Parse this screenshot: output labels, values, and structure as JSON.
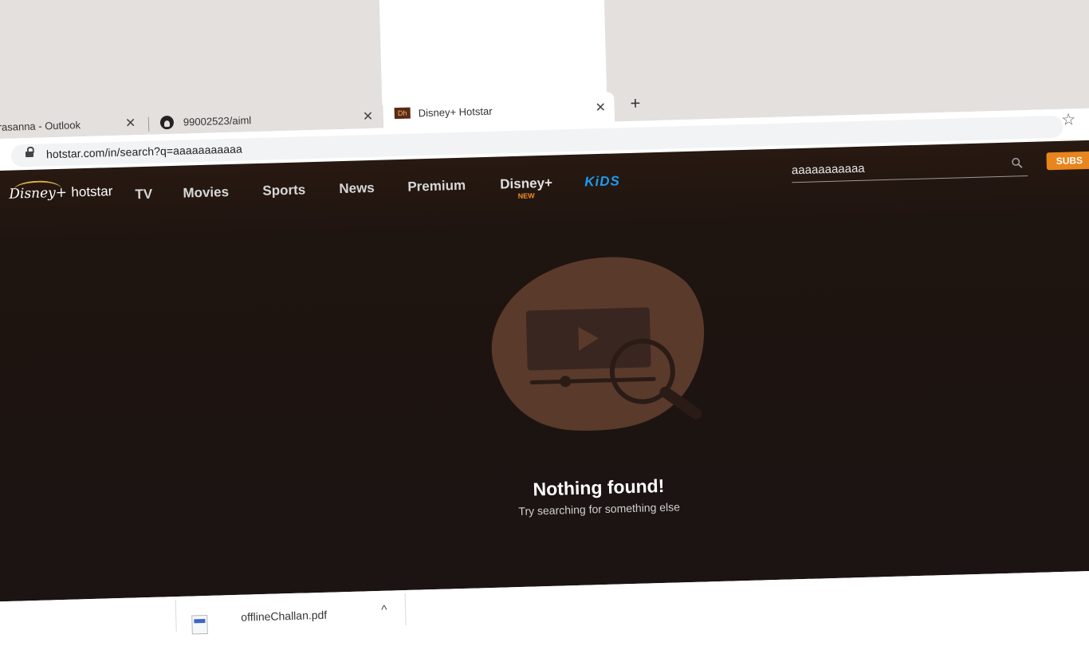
{
  "browser": {
    "tabs": [
      {
        "title": "Prasanna - Outlook",
        "icon": "outlook-icon"
      },
      {
        "title": "99002523/aiml",
        "icon": "github-icon"
      },
      {
        "title": "Disney+ Hotstar",
        "icon": "hotstar-favicon",
        "active": true
      }
    ],
    "close_glyph": "✕",
    "new_tab_glyph": "+",
    "url": "hotstar.com/in/search?q=aaaaaaaaaaa",
    "favicon_text": "Dh"
  },
  "hotstar": {
    "logo": {
      "brand": "Disney+",
      "name": "hotstar"
    },
    "nav": [
      {
        "label": "TV"
      },
      {
        "label": "Movies"
      },
      {
        "label": "Sports"
      },
      {
        "label": "News"
      },
      {
        "label": "Premium"
      },
      {
        "label": "Disney+",
        "badge": "NEW"
      },
      {
        "label": "KiDS"
      }
    ],
    "search_value": "aaaaaaaaaaa",
    "subscribe_label": "SUBS",
    "empty_title": "Nothing found!",
    "empty_subtitle": "Try searching for something else"
  },
  "downloads": {
    "file": "offlineChallan.pdf",
    "chevron": "^"
  },
  "colors": {
    "page_bg": "#1c1410",
    "blob": "#5a3a2b",
    "accent_orange": "#e8851c",
    "kids_blue": "#1f9bf0"
  }
}
